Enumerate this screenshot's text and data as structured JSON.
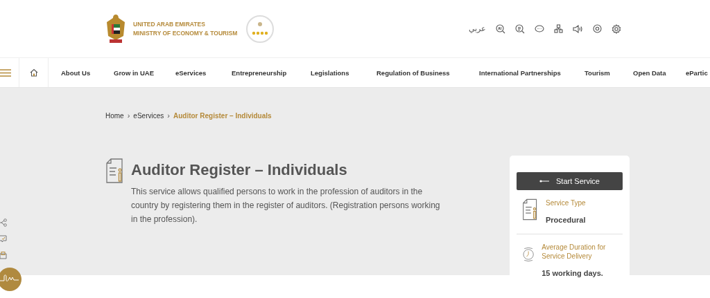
{
  "header": {
    "org_name": [
      "UNITED ARAB EMIRATES",
      "MINISTRY OF ECONOMY & TOURISM"
    ],
    "language_link": "عربي"
  },
  "nav": {
    "items": [
      "About Us",
      "Grow in UAE",
      "eServices",
      "Entrepreneurship",
      "Legislations",
      "Regulation of Business",
      "International Partnerships",
      "Tourism",
      "Open Data",
      "ePartic"
    ]
  },
  "breadcrumb": [
    {
      "label": "Home",
      "current": false
    },
    {
      "separator": "›",
      "label": "eServices",
      "current": false
    },
    {
      "separator": "›",
      "label": "Auditor Register – Individuals",
      "current": true
    }
  ],
  "service": {
    "title": "Auditor Register – Individuals",
    "description": "This service allows qualified persons to work in the profession of auditors in the country by registering them in the register of auditors. (Registration persons working in the profession)."
  },
  "card": {
    "button": "Start Service",
    "facts": [
      {
        "kind": "document",
        "label": "Service Type",
        "value": "Procedural"
      },
      {
        "kind": "clock",
        "label": "Average Duration for Service Delivery",
        "value": "15 working days."
      }
    ]
  }
}
